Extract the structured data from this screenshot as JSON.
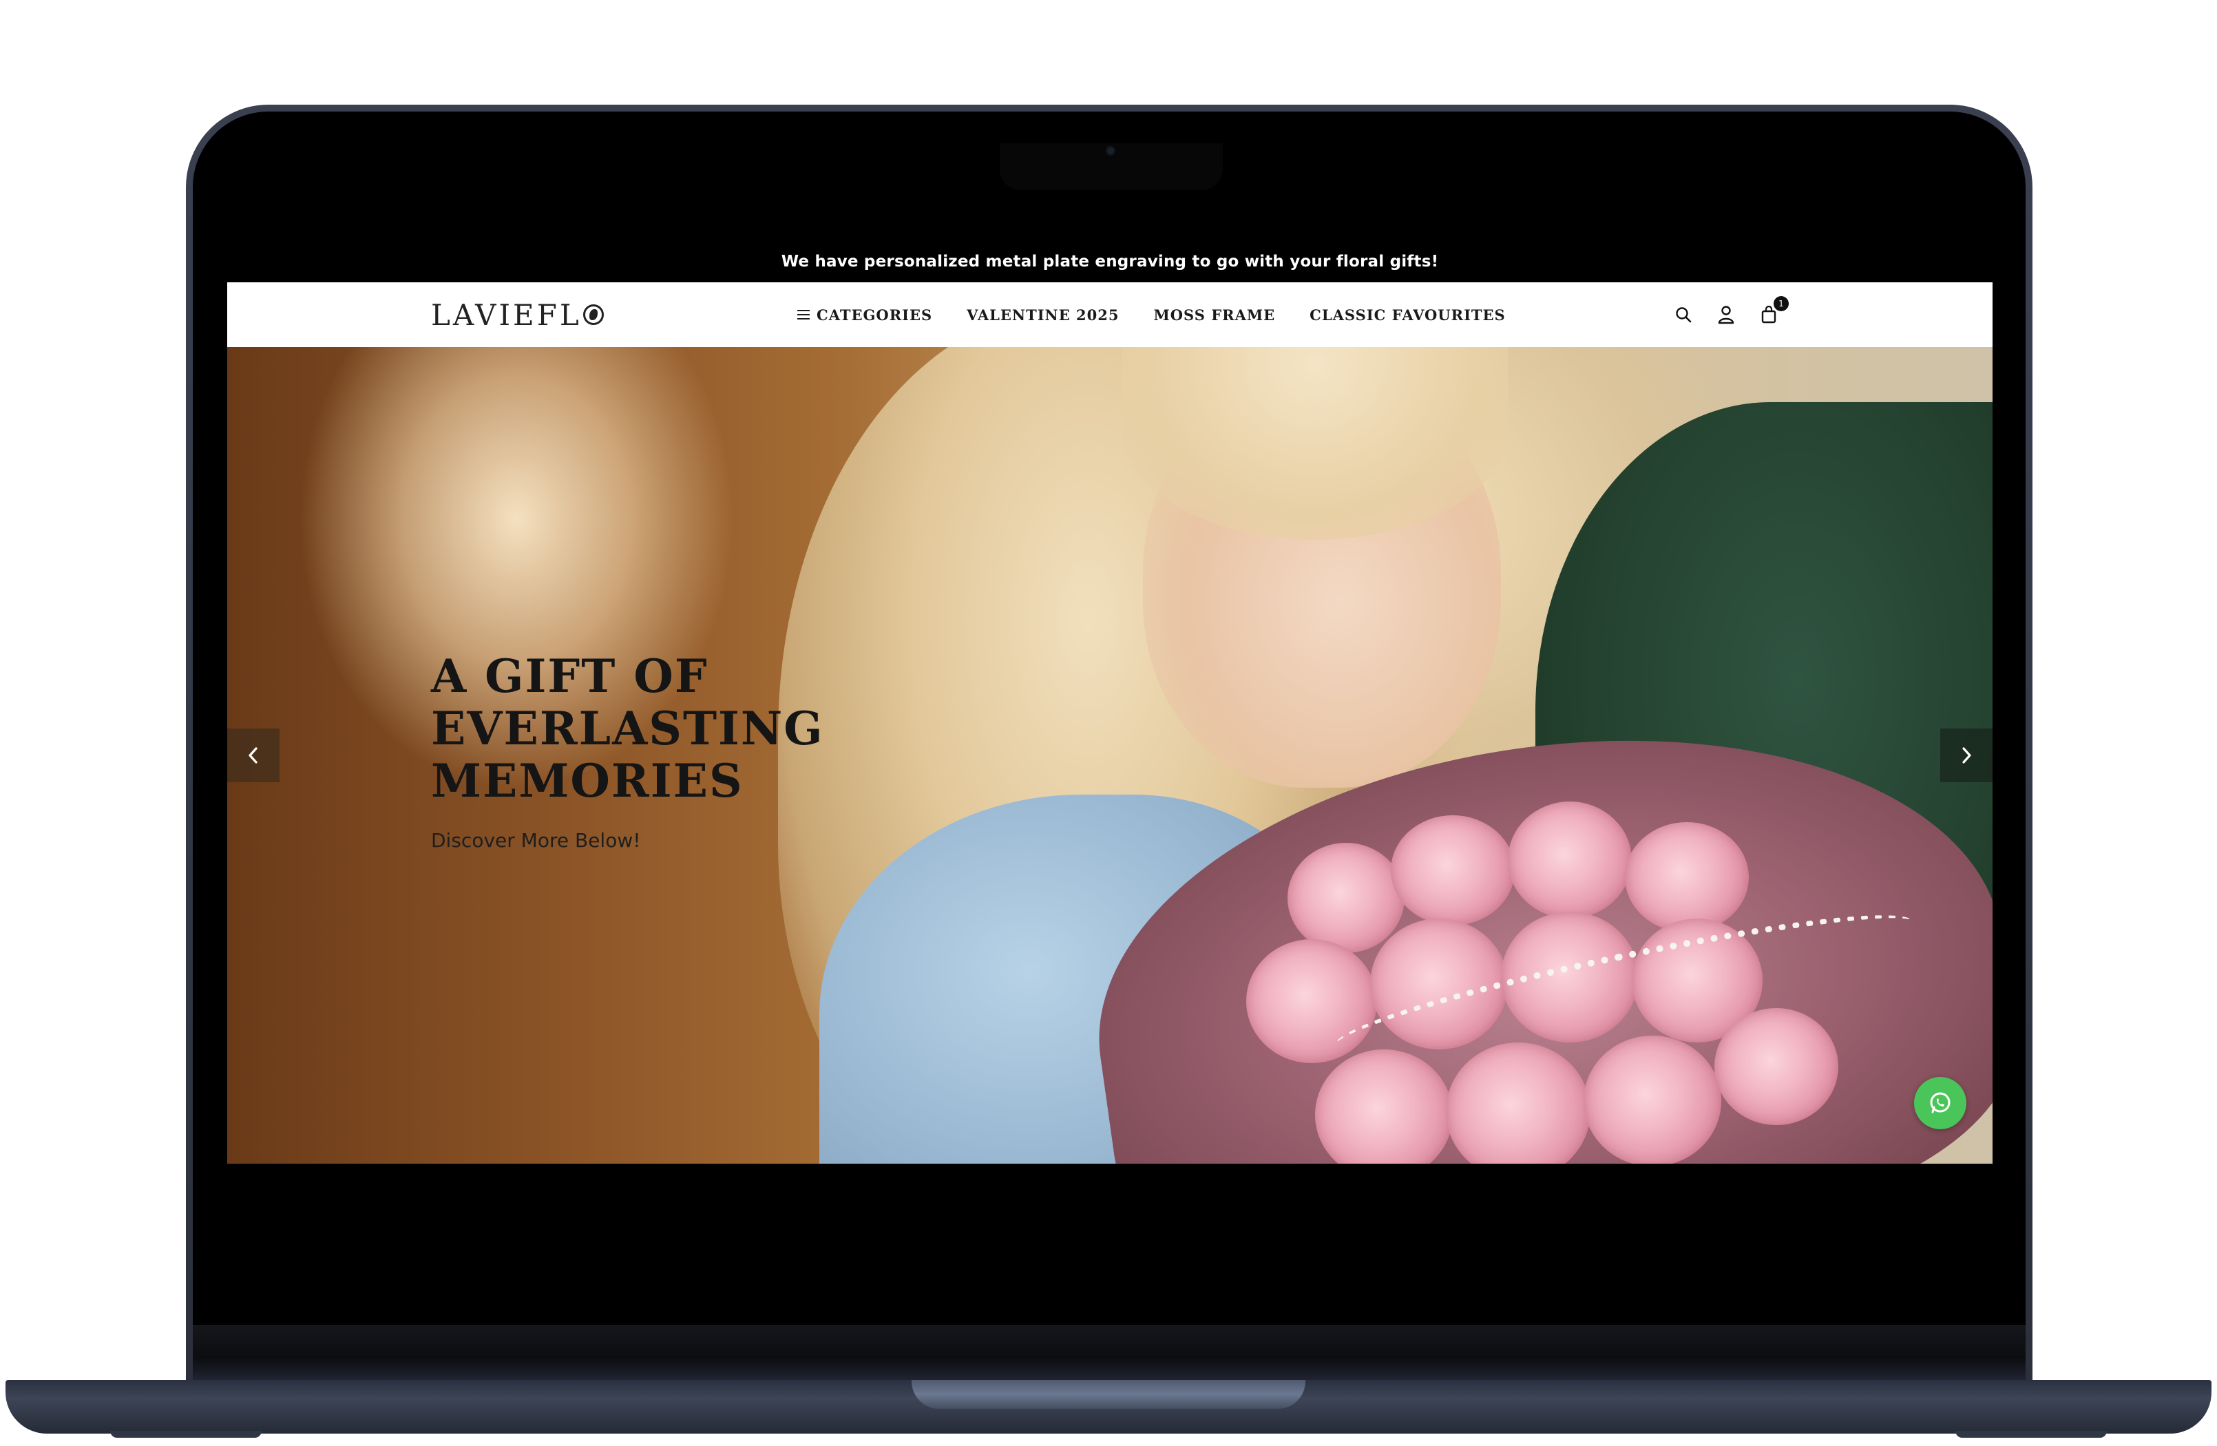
{
  "announcement": "We have personalized metal plate engraving to go with your floral gifts!",
  "header": {
    "logo_text": "LAVIEFL",
    "nav": [
      {
        "label": "CATEGORIES",
        "icon": "hamburger-icon"
      },
      {
        "label": "VALENTINE 2025"
      },
      {
        "label": "MOSS FRAME"
      },
      {
        "label": "CLASSIC FAVOURITES"
      }
    ],
    "icons": [
      "search-icon",
      "user-icon",
      "cart-icon"
    ],
    "cart_count": "1"
  },
  "hero": {
    "headline_lines": [
      "A GIFT OF",
      "EVERLASTING",
      "MEMORIES"
    ],
    "subline": "Discover More Below!",
    "prev_icon": "chevron-left-icon",
    "next_icon": "chevron-right-icon"
  },
  "chat_widget": {
    "icon": "whatsapp-icon",
    "color": "#4ac559"
  },
  "colors": {
    "header_bg": "#ffffff",
    "announcement_bg": "#000000",
    "text": "#151515"
  }
}
